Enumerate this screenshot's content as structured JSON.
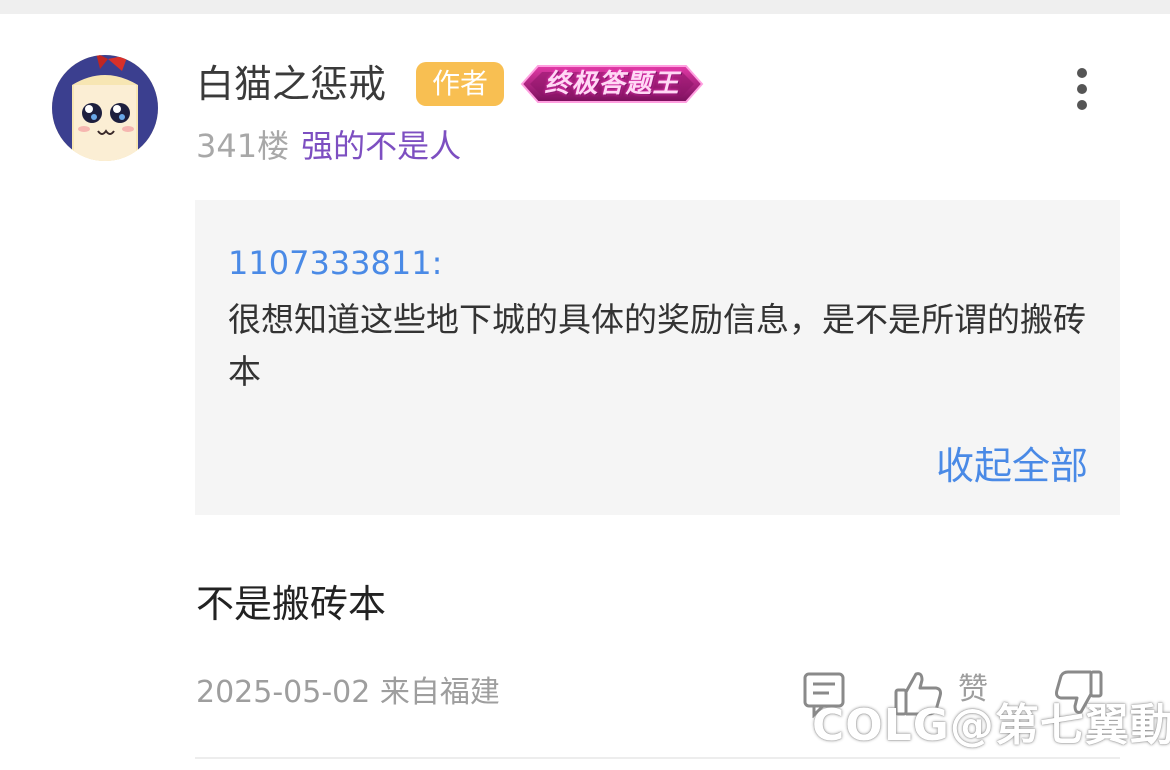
{
  "post": {
    "username": "白猫之惩戒",
    "author_badge": "作者",
    "title_badge": "终极答题王",
    "floor": "341楼",
    "user_tag": "强的不是人",
    "quote": {
      "user": "1107333811:",
      "text": "很想知道这些地下城的具体的奖励信息，是不是所谓的搬砖本",
      "collapse_label": "收起全部"
    },
    "reply_text": "不是搬砖本",
    "date": "2025-05-02",
    "location": "来自福建",
    "actions": {
      "comment_icon": "comment-icon",
      "like_icon": "thumbs-up-icon",
      "like_label": "赞",
      "dislike_icon": "thumbs-down-icon",
      "more_icon": "more-vertical-icon"
    }
  },
  "watermark": "COLG@第七翼動",
  "colors": {
    "author_badge": "#f8bf52",
    "link_blue": "#4a8ae6",
    "user_tag_purple": "#7d4fc1",
    "quote_bg": "#f5f5f5",
    "title_badge_magenta": "#c21e87"
  }
}
